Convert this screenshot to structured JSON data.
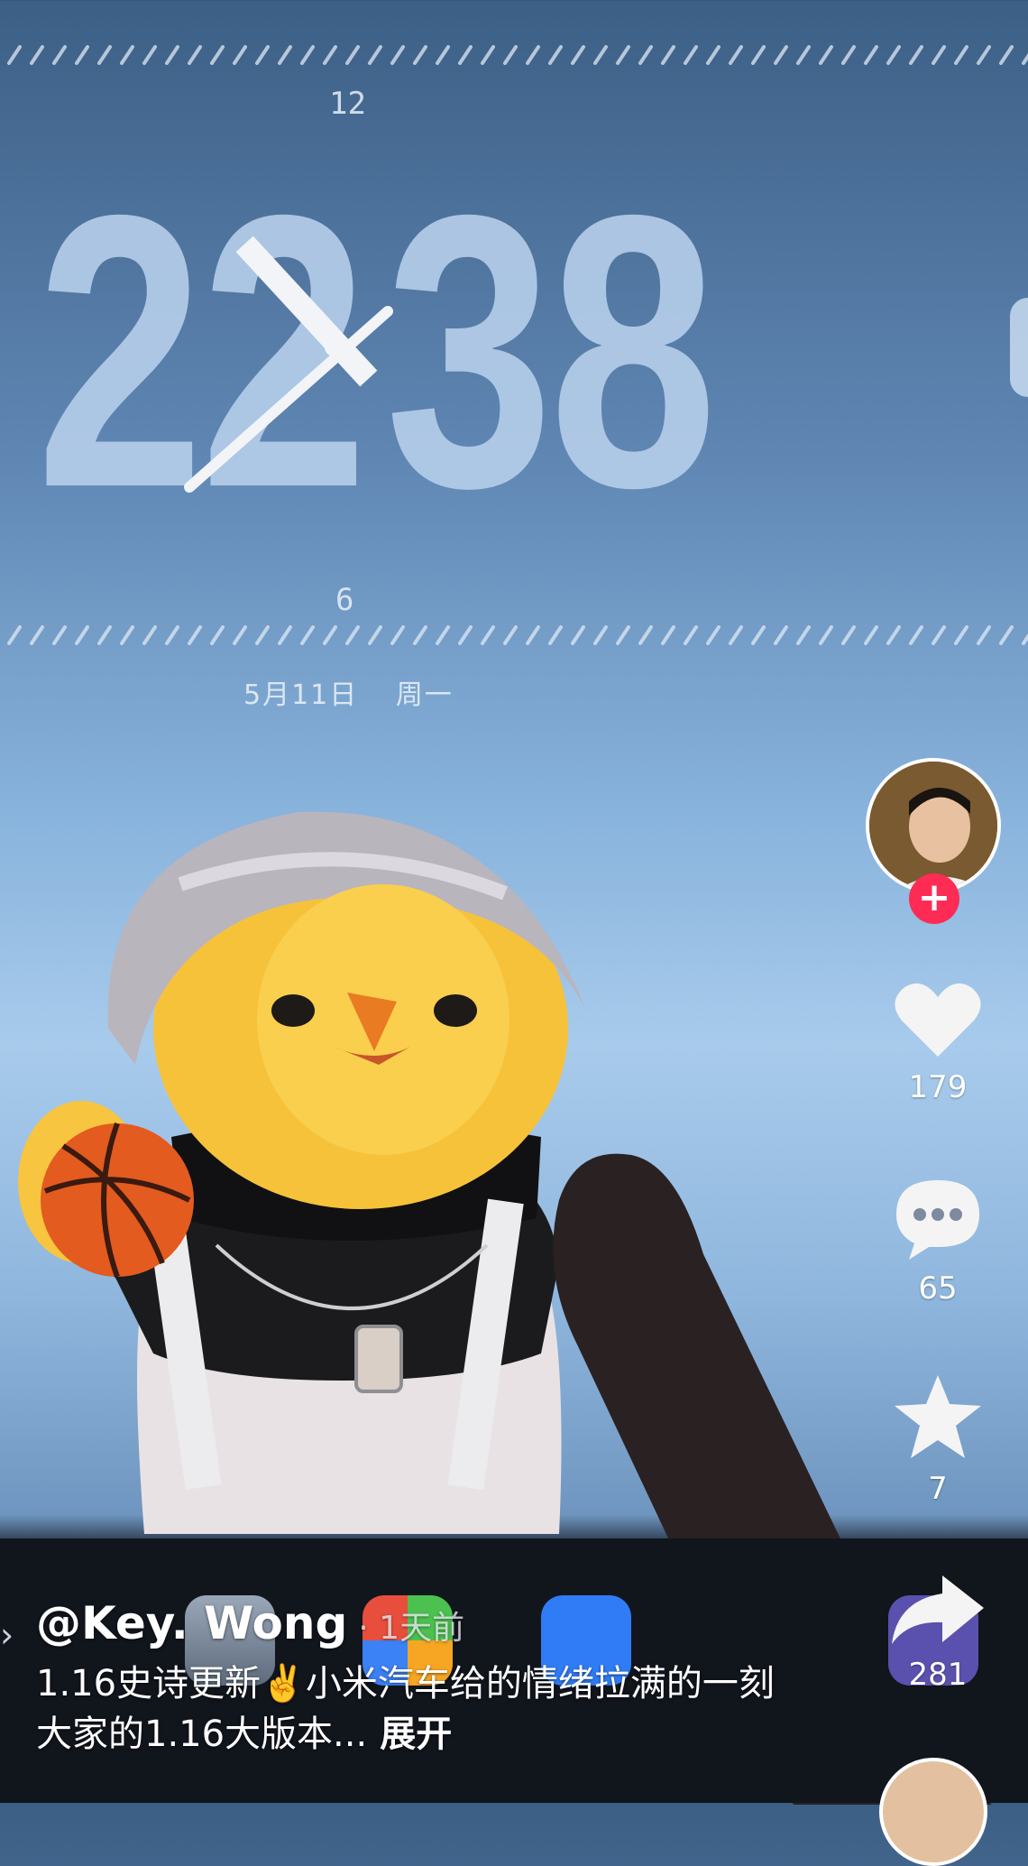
{
  "lockscreen": {
    "dial_top_label": "12",
    "dial_bottom_label": "6",
    "hours": "22",
    "minutes": "38",
    "date": "5月11日",
    "weekday": "周一"
  },
  "dock": {
    "apps": [
      "settings-app-icon",
      "maps-app-icon",
      "video-call-app-icon",
      "photos-app-icon"
    ]
  },
  "sidebar": {
    "like_count": "179",
    "comment_count": "65",
    "favorite_count": "7",
    "share_count": "281",
    "follow_symbol": "+"
  },
  "caption": {
    "author": "@Key. Wong",
    "age": "· 1天前",
    "description": "1.16史诗更新✌️小米汽车给的情绪拉满的一刻 大家的1.16大版本...",
    "expand_label": "展开"
  },
  "colors": {
    "accent_red": "#fe2c55",
    "time_color": "#b8d1ec"
  }
}
